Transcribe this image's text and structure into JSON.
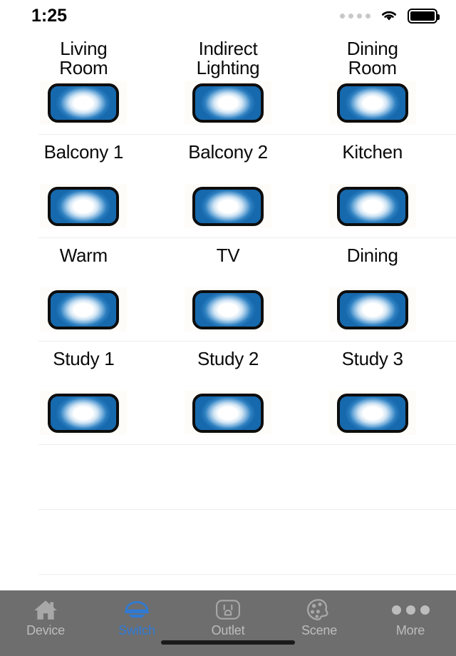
{
  "status_bar": {
    "time": "1:25",
    "signal_icon": "signal-dots-icon",
    "wifi_icon": "wifi-icon",
    "battery_icon": "battery-full-icon"
  },
  "theme": {
    "accent": "#2f7ad4",
    "switch_blue": "#1769ad",
    "tabbar_bg": "#6e6e6e",
    "separator": "#ededf0",
    "label_color": "#0a0a0a",
    "inactive_tab": "#bdbdbd"
  },
  "switch_list": {
    "rows": [
      {
        "cells": [
          {
            "label": "Living\nRoom",
            "icon": "light-switch-on-icon",
            "state": "on"
          },
          {
            "label": "Indirect\nLighting",
            "icon": "light-switch-on-icon",
            "state": "on"
          },
          {
            "label": "Dining\nRoom",
            "icon": "light-switch-on-icon",
            "state": "on"
          }
        ]
      },
      {
        "cells": [
          {
            "label": "Balcony 1",
            "icon": "light-switch-on-icon",
            "state": "on"
          },
          {
            "label": "Balcony 2",
            "icon": "light-switch-on-icon",
            "state": "on"
          },
          {
            "label": "Kitchen",
            "icon": "light-switch-on-icon",
            "state": "on"
          }
        ]
      },
      {
        "cells": [
          {
            "label": "Warm",
            "icon": "light-switch-on-icon",
            "state": "on"
          },
          {
            "label": "TV",
            "icon": "light-switch-on-icon",
            "state": "on"
          },
          {
            "label": "Dining",
            "icon": "light-switch-on-icon",
            "state": "on"
          }
        ]
      },
      {
        "cells": [
          {
            "label": "Study 1",
            "icon": "light-switch-on-icon",
            "state": "on"
          },
          {
            "label": "Study 2",
            "icon": "light-switch-on-icon",
            "state": "on"
          },
          {
            "label": "Study 3",
            "icon": "light-switch-on-icon",
            "state": "on"
          }
        ]
      }
    ]
  },
  "tab_bar": {
    "items": [
      {
        "label": "Device",
        "icon": "home-icon",
        "active": false
      },
      {
        "label": "Switch",
        "icon": "lamp-icon",
        "active": true
      },
      {
        "label": "Outlet",
        "icon": "power-outlet-icon",
        "active": false
      },
      {
        "label": "Scene",
        "icon": "palette-icon",
        "active": false
      },
      {
        "label": "More",
        "icon": "more-dots-icon",
        "active": false
      }
    ]
  }
}
